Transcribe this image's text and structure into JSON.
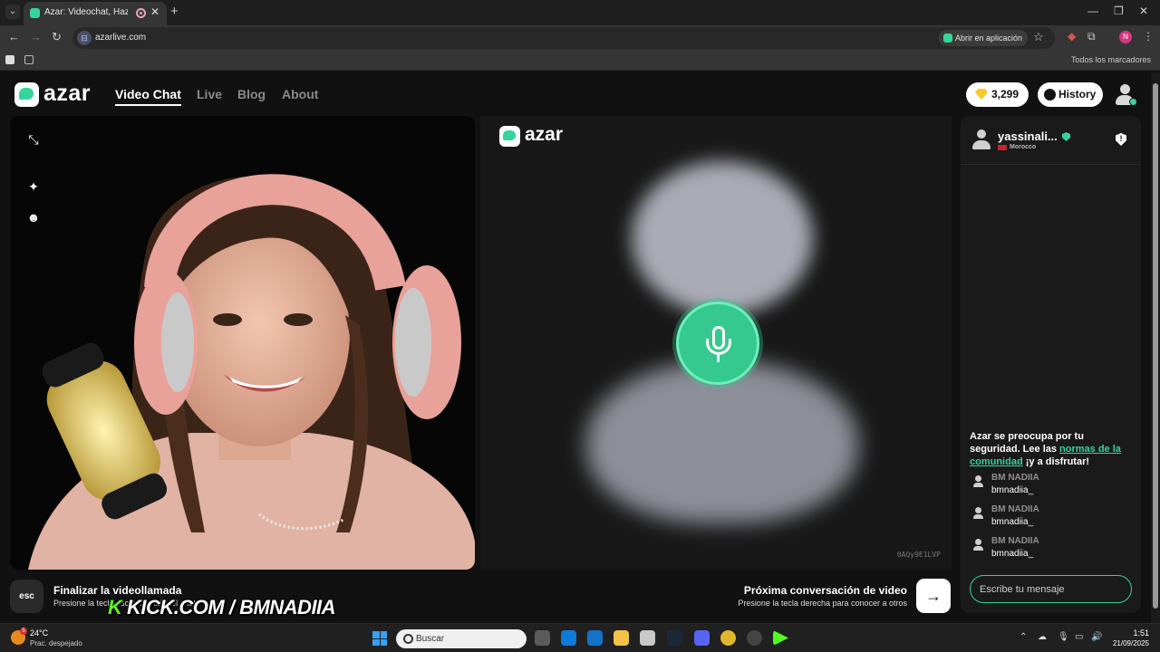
{
  "browser": {
    "tab_title": "Azar: Videochat, Haz nuevo",
    "url": "azarlive.com",
    "open_in_app": "Abrir en aplicación",
    "bookmarks_all": "Todos los marcadores",
    "profile_initial": "N",
    "ext_badge": "1"
  },
  "site": {
    "logo": "azar",
    "nav": [
      "Video Chat",
      "Live",
      "Blog",
      "About"
    ],
    "gems": "3,299",
    "history_label": "History"
  },
  "remote_video": {
    "logo": "azar",
    "call_id": "0AQy9E1LVP"
  },
  "chat": {
    "peer_name": "yassinali...",
    "peer_country": "Morocco",
    "safety_prefix": "Azar se preocupa por tu seguridad. Lee las ",
    "safety_link": "normas de la comunidad",
    "safety_suffix": " ¡y a disfrutar!",
    "messages": [
      {
        "from": "BM NADIIA",
        "text": "bmnadiia_"
      },
      {
        "from": "BM NADIIA",
        "text": "bmnadiia_"
      },
      {
        "from": "BM NADIIA",
        "text": "bmnadiia_"
      }
    ],
    "input_placeholder": "Escribe tu mensaje"
  },
  "controls": {
    "esc_label": "esc",
    "end_title": "Finalizar la videollamada",
    "end_sub": "Presione la tecla esc para salir del chat",
    "next_title": "Próxima conversación de video",
    "next_sub": "Presione la tecla derecha para conocer a otros",
    "next_arrow": "→"
  },
  "stream_overlay": {
    "k": "K",
    "text": "KICK.COM / BMNADIIA"
  },
  "taskbar": {
    "weather_badge": "5",
    "temperature": "24°C",
    "condition": "Prac. despejado",
    "search_placeholder": "Buscar",
    "time": "1:51",
    "date": "21/09/2025"
  },
  "colors": {
    "accent": "#35d49b",
    "page_bg": "#111111"
  }
}
